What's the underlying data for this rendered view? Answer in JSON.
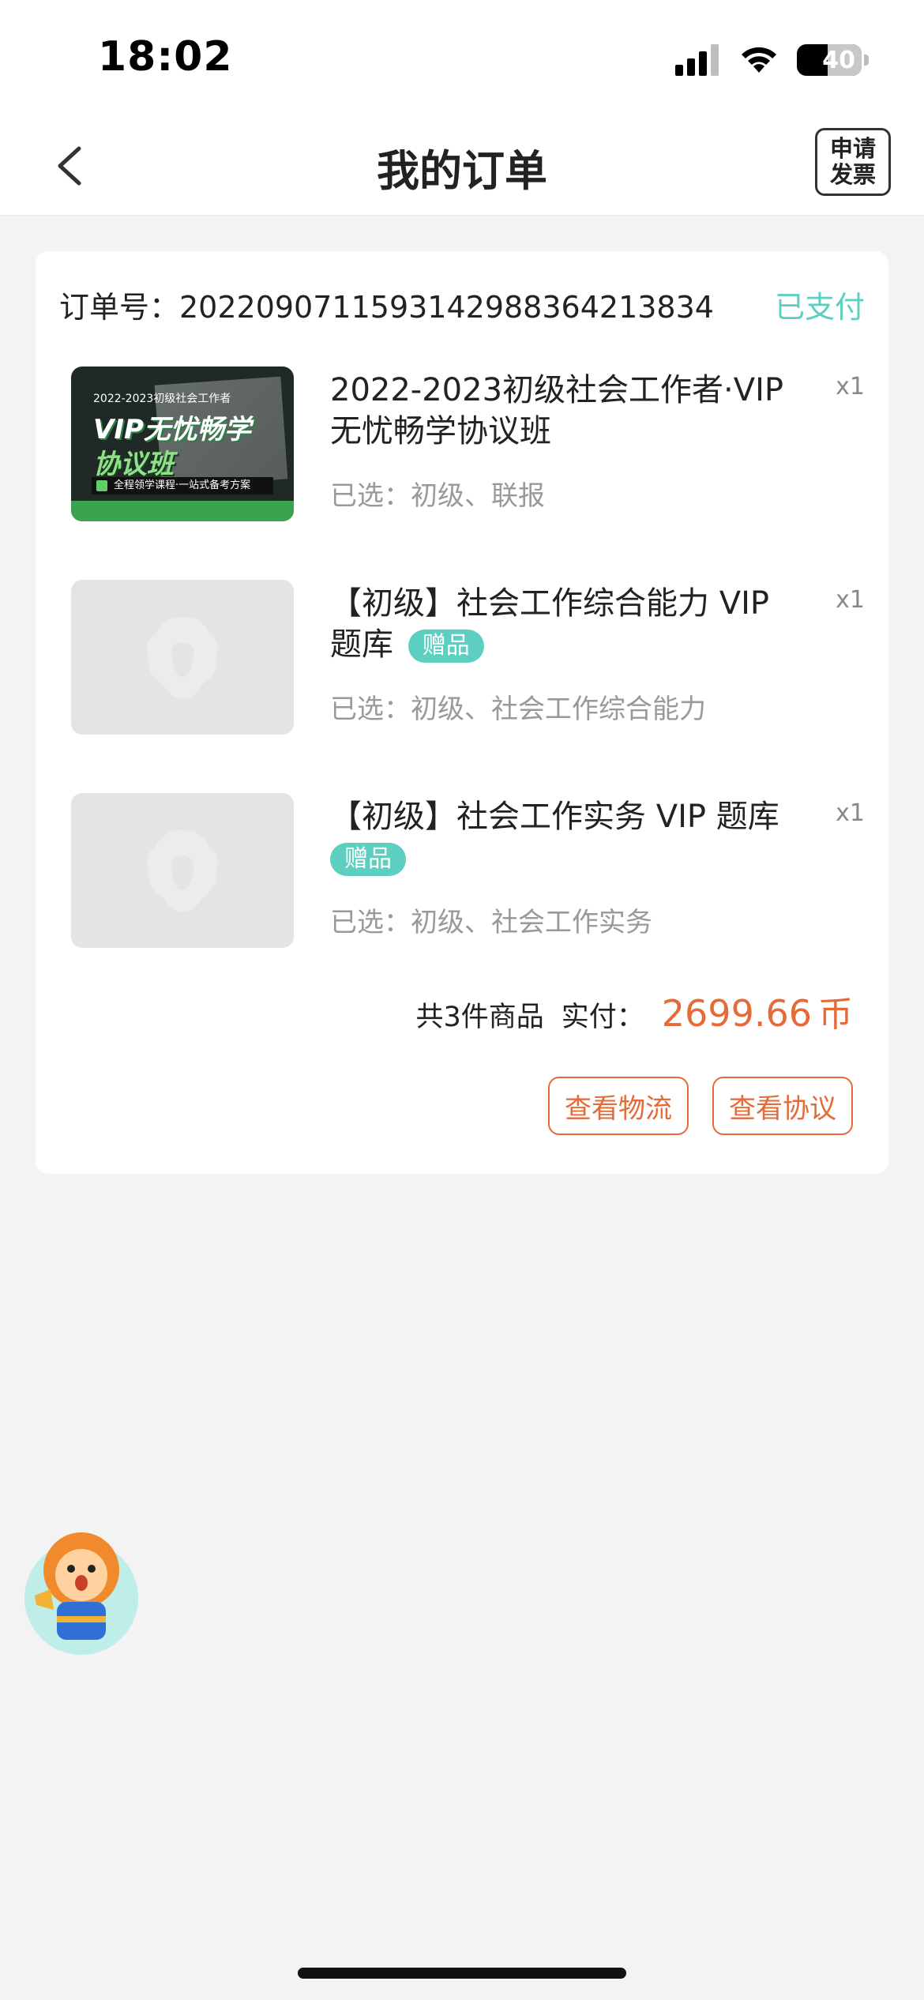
{
  "status_bar": {
    "time": "18:02",
    "battery": "40",
    "icons": [
      "signal-icon",
      "wifi-icon",
      "battery-icon"
    ]
  },
  "nav": {
    "title": "我的订单",
    "invoice_button": "申请\n发票",
    "back_icon": "chevron-left-icon"
  },
  "order": {
    "number_label": "订单号：20220907115931429883642138​34",
    "status": "已支付",
    "items": [
      {
        "title": "2022-2023初级社会工作者·VIP无忧畅学协议班",
        "qty": "x1",
        "selected": "已选：初级、联报",
        "cover": {
          "top": "2022-2023初级社会工作者",
          "vip": "VIP无忧畅学",
          "xy": "协议班",
          "strip": "全程领学课程·一站式备考方案"
        }
      },
      {
        "title": "【初级】社会工作综合能力 VIP 题库",
        "badge": "赠品",
        "qty": "x1",
        "selected": "已选：初级、社会工作综合能力"
      },
      {
        "title": "【初级】社会工作实务 VIP 题库",
        "badge": "赠品",
        "qty": "x1",
        "selected": "已选：初级、社会工作实务"
      }
    ],
    "summary": {
      "count": "共3件商品",
      "paid_label": "实付：",
      "amount": "2699.66",
      "unit": "币"
    },
    "actions": {
      "logistics": "查看物流",
      "agreement": "查看协议"
    }
  },
  "colors": {
    "accent_teal": "#5ccfc0",
    "accent_orange": "#e46a38",
    "background": "#f3f3f3"
  }
}
